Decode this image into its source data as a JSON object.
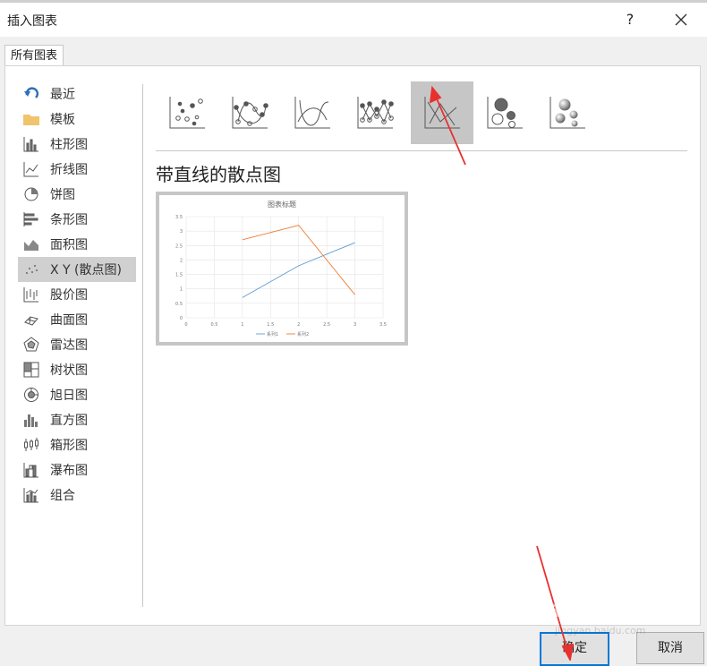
{
  "dialog": {
    "title": "插入图表",
    "help": "?",
    "tab": "所有图表"
  },
  "sidebar": {
    "items": [
      {
        "label": "最近",
        "icon": "undo-arrow-icon"
      },
      {
        "label": "模板",
        "icon": "folder-icon"
      },
      {
        "label": "柱形图",
        "icon": "column-chart-icon"
      },
      {
        "label": "折线图",
        "icon": "line-chart-icon"
      },
      {
        "label": "饼图",
        "icon": "pie-chart-icon"
      },
      {
        "label": "条形图",
        "icon": "bar-chart-icon"
      },
      {
        "label": "面积图",
        "icon": "area-chart-icon"
      },
      {
        "label": "X Y (散点图)",
        "icon": "scatter-chart-icon",
        "selected": true
      },
      {
        "label": "股价图",
        "icon": "stock-chart-icon"
      },
      {
        "label": "曲面图",
        "icon": "surface-chart-icon"
      },
      {
        "label": "雷达图",
        "icon": "radar-chart-icon"
      },
      {
        "label": "树状图",
        "icon": "treemap-chart-icon"
      },
      {
        "label": "旭日图",
        "icon": "sunburst-chart-icon"
      },
      {
        "label": "直方图",
        "icon": "histogram-chart-icon"
      },
      {
        "label": "箱形图",
        "icon": "box-whisker-chart-icon"
      },
      {
        "label": "瀑布图",
        "icon": "waterfall-chart-icon"
      },
      {
        "label": "组合",
        "icon": "combo-chart-icon"
      }
    ]
  },
  "subtypes": [
    {
      "icon": "scatter-icon"
    },
    {
      "icon": "scatter-smooth-markers-icon"
    },
    {
      "icon": "scatter-smooth-lines-icon"
    },
    {
      "icon": "scatter-straight-markers-icon"
    },
    {
      "icon": "scatter-straight-lines-icon",
      "selected": true
    },
    {
      "icon": "bubble-icon"
    },
    {
      "icon": "bubble-3d-icon"
    }
  ],
  "selected_subtype_title": "带直线的散点图",
  "chart_data": {
    "type": "line",
    "title": "图表标题",
    "x_ticks": [
      "0",
      "0.5",
      "1",
      "1.5",
      "2",
      "2.5",
      "3",
      "3.5"
    ],
    "y_ticks": [
      "0",
      "0.5",
      "1",
      "1.5",
      "2",
      "2.5",
      "3",
      "3.5"
    ],
    "xlim": [
      0,
      3.5
    ],
    "ylim": [
      0,
      3.5
    ],
    "grid": true,
    "legend": "bottom",
    "series": [
      {
        "name": "系列1",
        "color": "#5b9bd5",
        "points": [
          [
            1,
            0.7
          ],
          [
            2,
            1.8
          ],
          [
            3,
            2.6
          ]
        ]
      },
      {
        "name": "系列2",
        "color": "#ed7d31",
        "points": [
          [
            1,
            2.7
          ],
          [
            2,
            3.2
          ],
          [
            3,
            0.8
          ]
        ]
      }
    ]
  },
  "buttons": {
    "ok": "确定",
    "cancel": "取消"
  },
  "watermark": {
    "text": "Bai du 经验",
    "url": "jingyan.baidu.com"
  },
  "colors": {
    "accent": "#0078d7",
    "annotation_arrow": "#e8312f"
  }
}
